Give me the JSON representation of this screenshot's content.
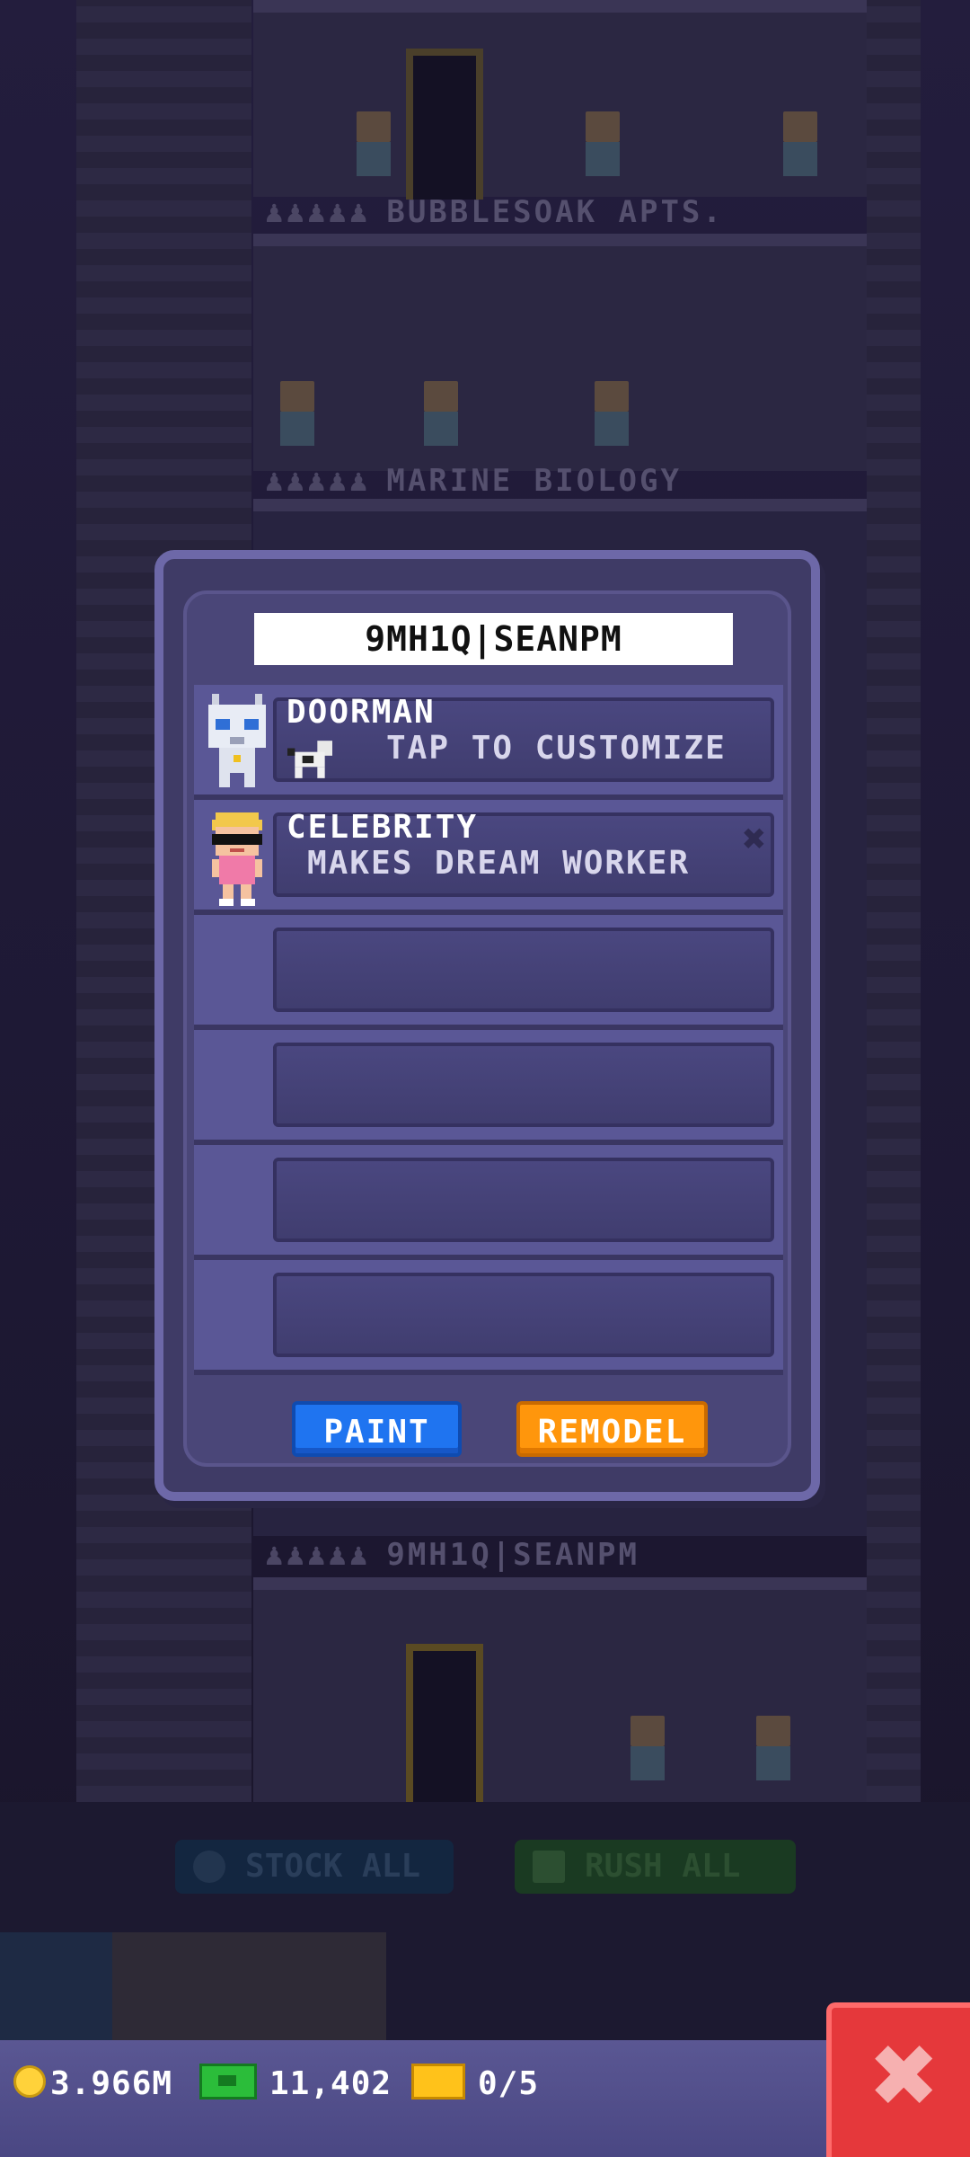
{
  "background": {
    "floors": [
      {
        "label": "BUBBLESOAK APTS."
      },
      {
        "label": "MARINE BIOLOGY"
      },
      {
        "label": "9MH1Q|SEANPM"
      }
    ],
    "stock_all_label": "STOCK ALL",
    "rush_all_label": "RUSH ALL"
  },
  "dialog": {
    "floor_name": "9MH1Q|SEANPM",
    "slots": [
      {
        "title": "DOORMAN",
        "subtitle": "TAP TO CUSTOMIZE",
        "avatar": "robot-doorman"
      },
      {
        "title": "CELEBRITY",
        "subtitle": "MAKES DREAM WORKER",
        "avatar": "celebrity-person"
      },
      {
        "title": "",
        "subtitle": ""
      },
      {
        "title": "",
        "subtitle": ""
      },
      {
        "title": "",
        "subtitle": ""
      },
      {
        "title": "",
        "subtitle": ""
      }
    ],
    "paint_label": "PAINT",
    "remodel_label": "REMODEL"
  },
  "status_bar": {
    "coins": "3.966M",
    "bux": "11,402",
    "tickets": "0/5"
  },
  "icons": {
    "coin": "coin-icon",
    "bux": "bux-icon",
    "ticket": "ticket-icon",
    "close": "close-icon"
  },
  "colors": {
    "paint_button": "#1f74f0",
    "remodel_button": "#ff960c",
    "close_button": "#e5383b",
    "dialog_bg": "#3f3b66"
  }
}
